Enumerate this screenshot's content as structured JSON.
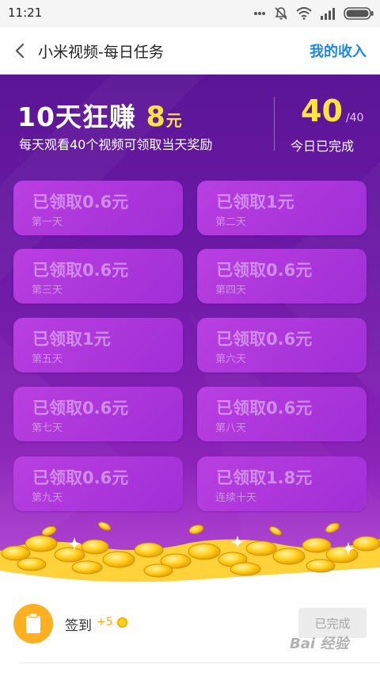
{
  "status_bar": {
    "time": "11:21"
  },
  "header": {
    "title": "小米视频-每日任务",
    "income_link": "我的收入"
  },
  "hero": {
    "title_prefix": "10天狂赚",
    "amount": "8",
    "unit": "元",
    "subtitle": "每天观看40个视频可领取当天奖励",
    "progress_done": "40",
    "progress_total": "/40",
    "progress_label": "今日已完成"
  },
  "days": [
    {
      "main": "已领取0.6元",
      "sub": "第一天"
    },
    {
      "main": "已领取1元",
      "sub": "第二天"
    },
    {
      "main": "已领取0.6元",
      "sub": "第三天"
    },
    {
      "main": "已领取0.6元",
      "sub": "第四天"
    },
    {
      "main": "已领取1元",
      "sub": "第五天"
    },
    {
      "main": "已领取0.6元",
      "sub": "第六天"
    },
    {
      "main": "已领取0.6元",
      "sub": "第七天"
    },
    {
      "main": "已领取0.6元",
      "sub": "第八天"
    },
    {
      "main": "已领取0.6元",
      "sub": "第九天"
    },
    {
      "main": "已领取1.8元",
      "sub": "连续十天"
    }
  ],
  "task": {
    "name": "签到",
    "reward": "+5",
    "button": "已完成",
    "icon": "clipboard-icon"
  },
  "watermark": "Bai 经验",
  "colors": {
    "purple": "#6e1aa8",
    "yellow": "#ffe53b",
    "link_blue": "#1e88e5",
    "task_orange": "#ffb020"
  }
}
